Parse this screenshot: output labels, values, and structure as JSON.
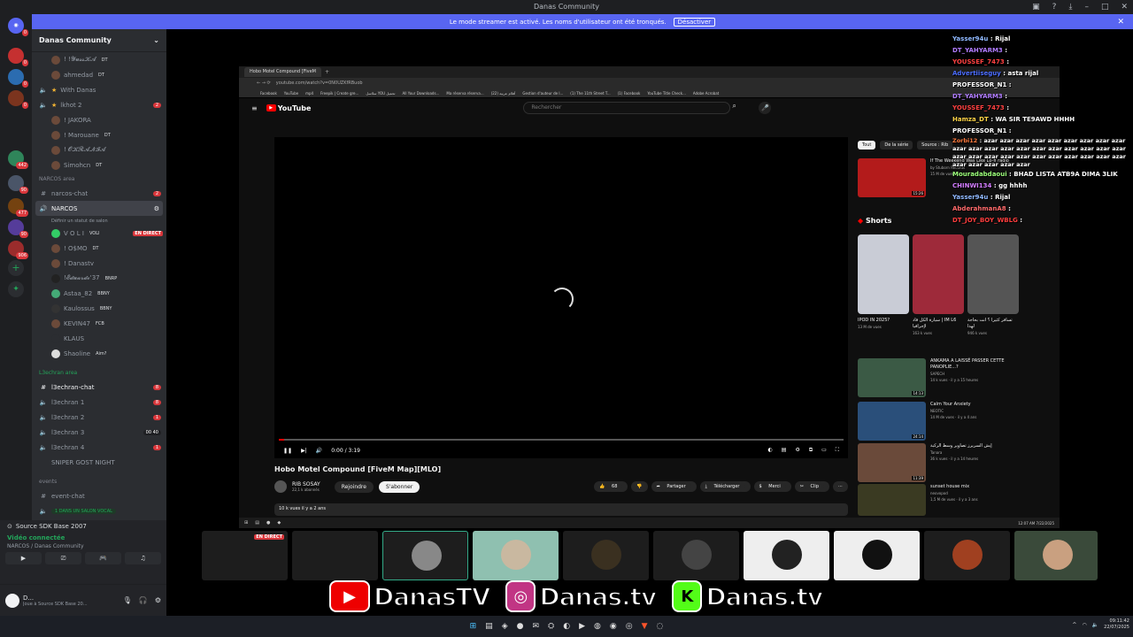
{
  "window": {
    "title": "Danas Community"
  },
  "notice": {
    "text": "Le mode streamer est activé. Les noms d'utilisateur ont été tronqués.",
    "button": "Désactiver"
  },
  "servers": [
    {
      "label": "",
      "badge": "0"
    },
    {
      "label": "",
      "badge": "0"
    },
    {
      "label": "",
      "badge": "0"
    },
    {
      "label": "",
      "badge": "0"
    },
    {
      "label": "",
      "badge": "442"
    },
    {
      "label": "",
      "badge": "90"
    },
    {
      "label": "",
      "badge": "477"
    },
    {
      "label": "",
      "badge": "90"
    },
    {
      "label": "",
      "badge": "906"
    }
  ],
  "sidebar": {
    "server_name": "Danas Community",
    "members_top": [
      {
        "name": "! !𝓨𝓾𝓼𝓼𝓚𝓐",
        "tag": "DT"
      },
      {
        "name": "ahmedad",
        "tag": "DT"
      }
    ],
    "channels": [
      {
        "name": "With Danas"
      },
      {
        "name": "lkhot 2",
        "badge": "2"
      }
    ],
    "voice_members_1": [
      {
        "name": "! JAKORA",
        "tag": ""
      },
      {
        "name": "! Marouane",
        "tag": "DT"
      },
      {
        "name": "! 𝓞𝓚𝓡𝓐𝓝𝓘𝓐",
        "tag": ""
      },
      {
        "name": "Simohcn",
        "tag": "DT"
      }
    ],
    "cat_narcos": "NARCOS area",
    "narcos_chat": "narcos-chat",
    "narcos_chat_badge": "2",
    "narcos_voice": "NARCOS",
    "narcos_status": "Définir un statut de salon",
    "narcos_members": [
      {
        "name": "V O L I",
        "tag": "VOLI",
        "live": "EN DIRECT"
      },
      {
        "name": "! O$MO",
        "tag": "DT"
      },
      {
        "name": "! Danastv",
        "tag": ""
      },
      {
        "name": "!𝓔𝓭𝓾𝓪𝓻𝓭𝓸'37",
        "tag": "BNRP"
      },
      {
        "name": "Astaa_82",
        "tag": "BBNY"
      },
      {
        "name": "Kaulossus",
        "tag": "BBNY"
      },
      {
        "name": "KEVIN47",
        "tag": "FCB"
      },
      {
        "name": "KLAUS",
        "tag": ""
      },
      {
        "name": "Shaoline",
        "tag": "Aim?"
      }
    ],
    "cat_l3echran": "L3echran area",
    "l3echran_chat": "l3echran-chat",
    "l3echran_chat_badge": "8",
    "l3echran_voice": [
      {
        "name": "l3echran 1",
        "badge": "8"
      },
      {
        "name": "l3echran 2",
        "badge": "1"
      },
      {
        "name": "l3echran 3",
        "badge": "00 40"
      },
      {
        "name": "l3echran 4",
        "badge": "1"
      }
    ],
    "sniper": "SNIPER GOST NIGHT",
    "cat_events": "events",
    "event_chat": "event-chat",
    "event_voice": "1 DANS UN SALON VOCAL"
  },
  "voice_panel": {
    "activity": "Source SDK Base 2007",
    "status": "Vidéo connectée",
    "location": "NARCOS / Danas Community"
  },
  "user_panel": {
    "name": "D...",
    "status": "Joue à Source SDK Base 20..."
  },
  "browser": {
    "tab_title": "Hobo Motel Compound [FiveM",
    "url": "youtube.com/watch?v=0N0UZKfRBuob",
    "bookmarks": [
      "Facebook",
      "YouTube",
      "mp4",
      "Freepik | Create gre...",
      "سلاسل YOU تحميل",
      "All Your Downloads...",
      "Ma réserva réserva...",
      "أفلام عربية (22)",
      "Gestion d'auteur de l...",
      "(1) The 11th Street T...",
      "(1) Facebook",
      "YouTube Title Check...",
      "Adobe Acrobat"
    ]
  },
  "youtube": {
    "logo": "YouTube",
    "search_placeholder": "Rechercher",
    "time": "0:00 / 3:19",
    "progress": 0.01,
    "video_title": "Hobo Motel Compound [FiveM Map][MLO]",
    "channel": "RIB SOSAY",
    "subs": "22,1 k abonnés",
    "join": "Rejoindre",
    "subscribe": "S'abonner",
    "likes": "68",
    "share": "Partager",
    "download": "Télécharger",
    "thanks": "Merci",
    "clip": "Clip",
    "views": "10 k vues  il y a 2 ans",
    "chips": [
      "Tout",
      "De la série",
      "Source : Rib"
    ],
    "top_video": {
      "title": "If The Weekend Was Like Lo-fi radio",
      "channel": "by Stuborn Records",
      "meta": "15 M de vues",
      "dur": "15:26"
    },
    "shorts_label": "Shorts",
    "shorts": [
      {
        "title": "IPOD IN 2025?",
        "views": "13 M de vues"
      },
      {
        "title": "سيارة الكل قاد | IM L6 لإجرافيا",
        "views": "163 k vues"
      },
      {
        "title": "تسافر كثيرا ؟ انت بحاجة لهذا",
        "views": "946 k vues"
      }
    ],
    "videos": [
      {
        "title": "ANKAMA A LAISSÉ PASSER CETTE PANOPLIE...?",
        "channel": "SAPECH",
        "meta": "14 k vues · il y a 15 heures",
        "dur": "14:13"
      },
      {
        "title": "Calm Your Anxiety",
        "channel": "NEOTIC",
        "meta": "14 M de vues · il y a 4 ans",
        "dur": "24:14"
      },
      {
        "title": "إيش السريرز تصاوير وسط الركبة",
        "channel": "Tanara",
        "meta": "36 k vues · il y a 14 heures",
        "dur": "11:39"
      },
      {
        "title": "sunset house mix",
        "channel": "neovopod",
        "meta": "1,5 M de vues · il y a 3 ans",
        "dur": ""
      }
    ],
    "inner_clock": "12:07 AM\n7/22/2025"
  },
  "chat": [
    {
      "user": "Yasser94u",
      "text": "Rijal",
      "color": "#8fb8ff"
    },
    {
      "user": "DT_YAHYARM3",
      "text": "",
      "color": "#b07cff"
    },
    {
      "user": "YOUSSEF_7473",
      "text": "",
      "color": "#ff4040"
    },
    {
      "user": "Advertiiseguy",
      "text": "asta rijal",
      "color": "#4b6cff"
    },
    {
      "user": "PROFESSOR_N1",
      "text": "",
      "color": "#ffffff"
    },
    {
      "user": "DT_YAHYARM3",
      "text": "",
      "color": "#b07cff"
    },
    {
      "user": "YOUSSEF_7473",
      "text": "",
      "color": "#ff4040"
    },
    {
      "user": "Hamza_DT",
      "text": "WA SIR TE9AWD HHHH",
      "color": "#ffd447"
    },
    {
      "user": "PROFESSOR_N1",
      "text": "",
      "color": "#ffffff"
    },
    {
      "user": "Zorbi12",
      "text": "azar azar azar azar azar azar azar azar azar azar azar azar azar azar azar azar azar azar azar azar azar azar azar azar azar azar azar azar azar azar azar azar azar azar azar azar",
      "color": "#ff7a3d"
    },
    {
      "user": "Mouradabdaoui",
      "text": "BHAD LISTA ATB9A DIMA 3LIK",
      "color": "#9cff7a"
    },
    {
      "user": "CHINWI134",
      "text": "gg hhhh",
      "color": "#d27cff"
    },
    {
      "user": "Yasser94u",
      "text": "Rijal",
      "color": "#8fb8ff"
    },
    {
      "user": "AbderahmanA8",
      "text": "",
      "color": "#ff6a6a"
    },
    {
      "user": "DT_JOY_BOY_WBLG",
      "text": "",
      "color": "#ff3d3d"
    }
  ],
  "cam_live": "EN DIRECT",
  "banner": {
    "yt": "DanasTV",
    "ig": "Danas.tv",
    "kick": "Danas.tv"
  },
  "taskbar": {
    "time": "09:11:42",
    "date": "22/07/2025"
  }
}
